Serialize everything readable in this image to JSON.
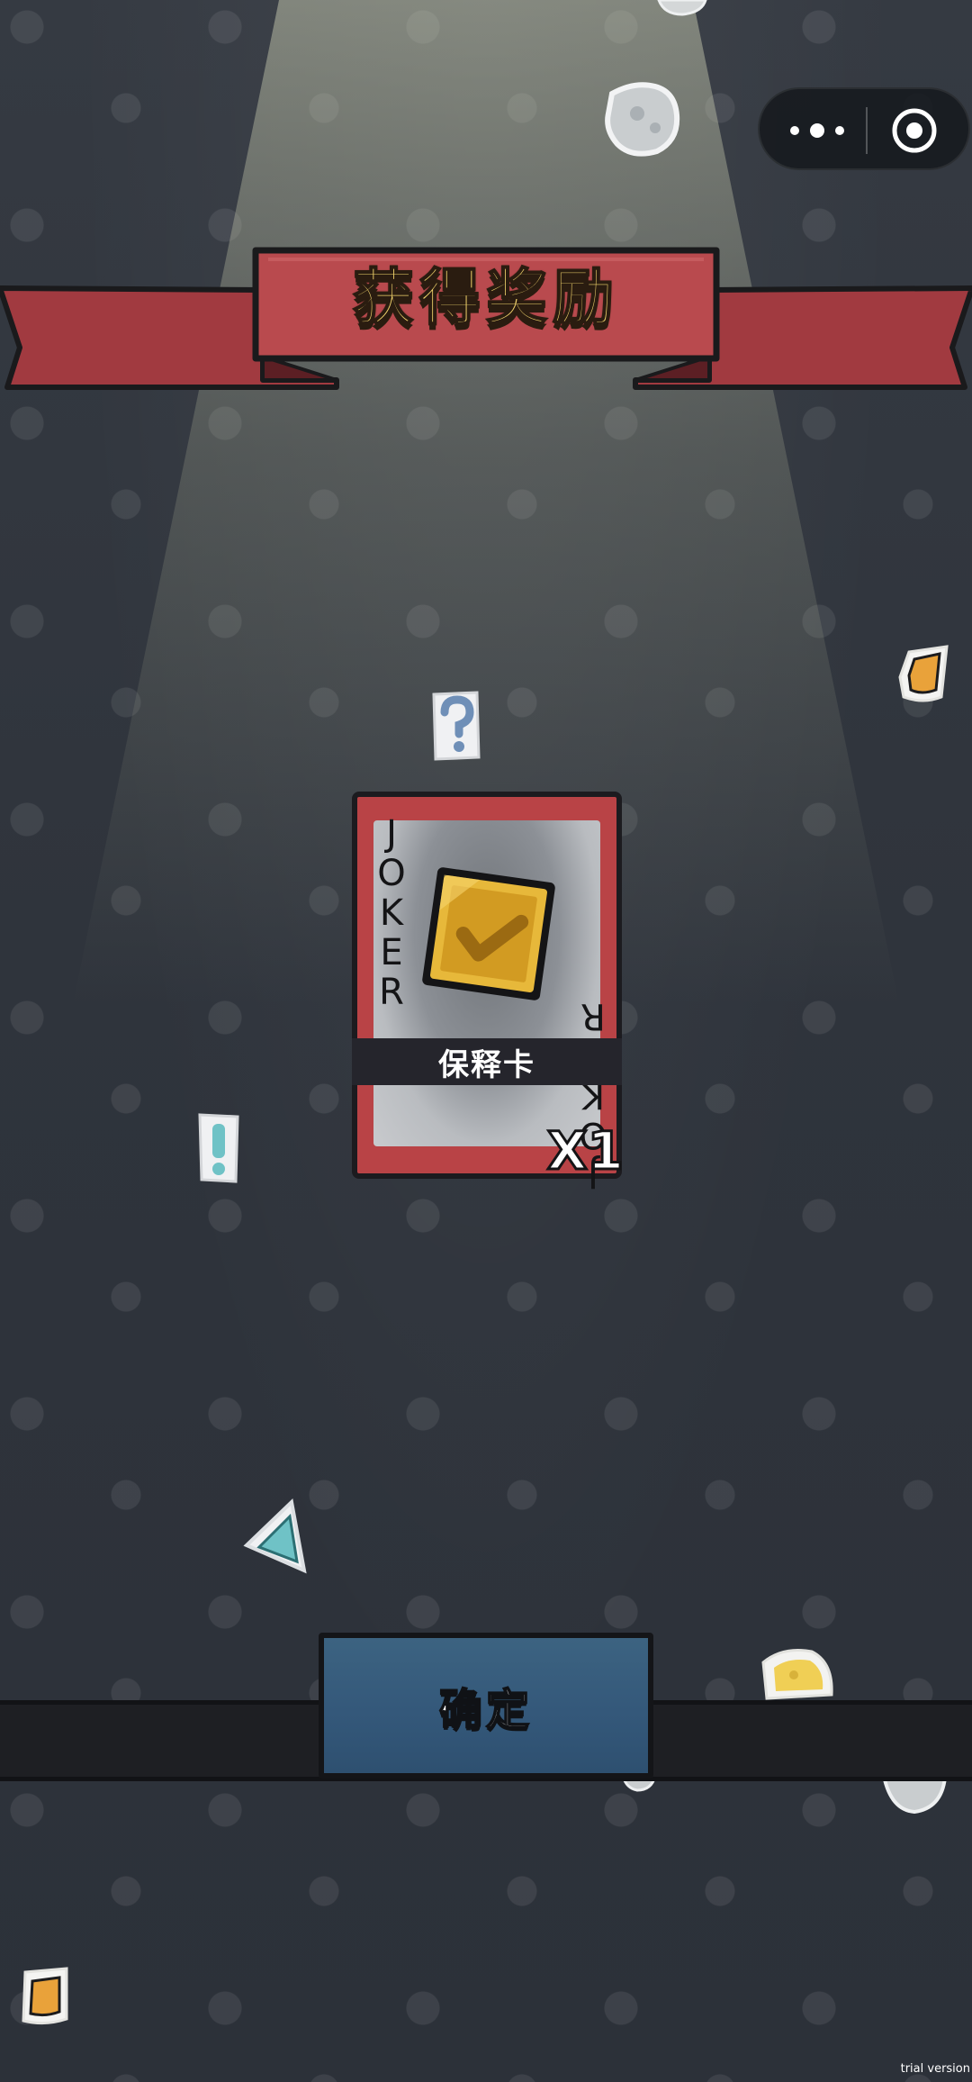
{
  "title": "获得奖励",
  "capsule": {
    "more_icon": "more-dots-icon",
    "close_icon": "target-close-icon"
  },
  "reward_card": {
    "suit_text_top": "JOKER",
    "suit_text_bottom": "JOKER",
    "item_name": "保释卡",
    "quantity": "X1",
    "emblem_icon": "gold-shield-check-icon",
    "card_color": "#b94346"
  },
  "confirm": {
    "label": "确定",
    "color": "#34587a"
  },
  "stickers": [
    "cheese-sticker",
    "question-mark-sticker",
    "orange-note-sticker",
    "exclamation-sticker",
    "teal-triangle-sticker",
    "cheese-wedge-sticker",
    "gray-paper-sticker"
  ],
  "watermark": "trial version"
}
